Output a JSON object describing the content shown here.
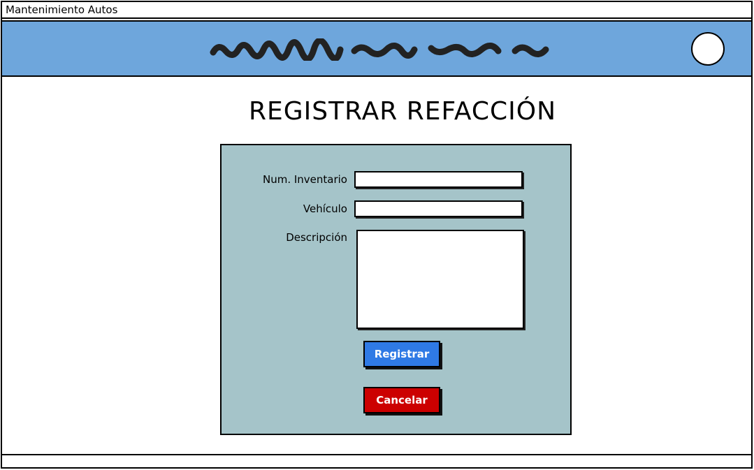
{
  "window": {
    "title": "Mantenimiento Autos"
  },
  "header": {
    "avatar_icon": "user-avatar-icon"
  },
  "page": {
    "title": "REGISTRAR REFACCIÓN"
  },
  "form": {
    "inventario_label": "Num. Inventario",
    "inventario_value": "",
    "vehiculo_label": "Vehículo",
    "vehiculo_value": "",
    "descripcion_label": "Descripción",
    "descripcion_value": ""
  },
  "buttons": {
    "register_label": "Registrar",
    "cancel_label": "Cancelar"
  },
  "colors": {
    "header": "#6ea6dc",
    "panel": "#a5c4c9",
    "primary": "#2f7ae5",
    "danger": "#cc0000"
  }
}
